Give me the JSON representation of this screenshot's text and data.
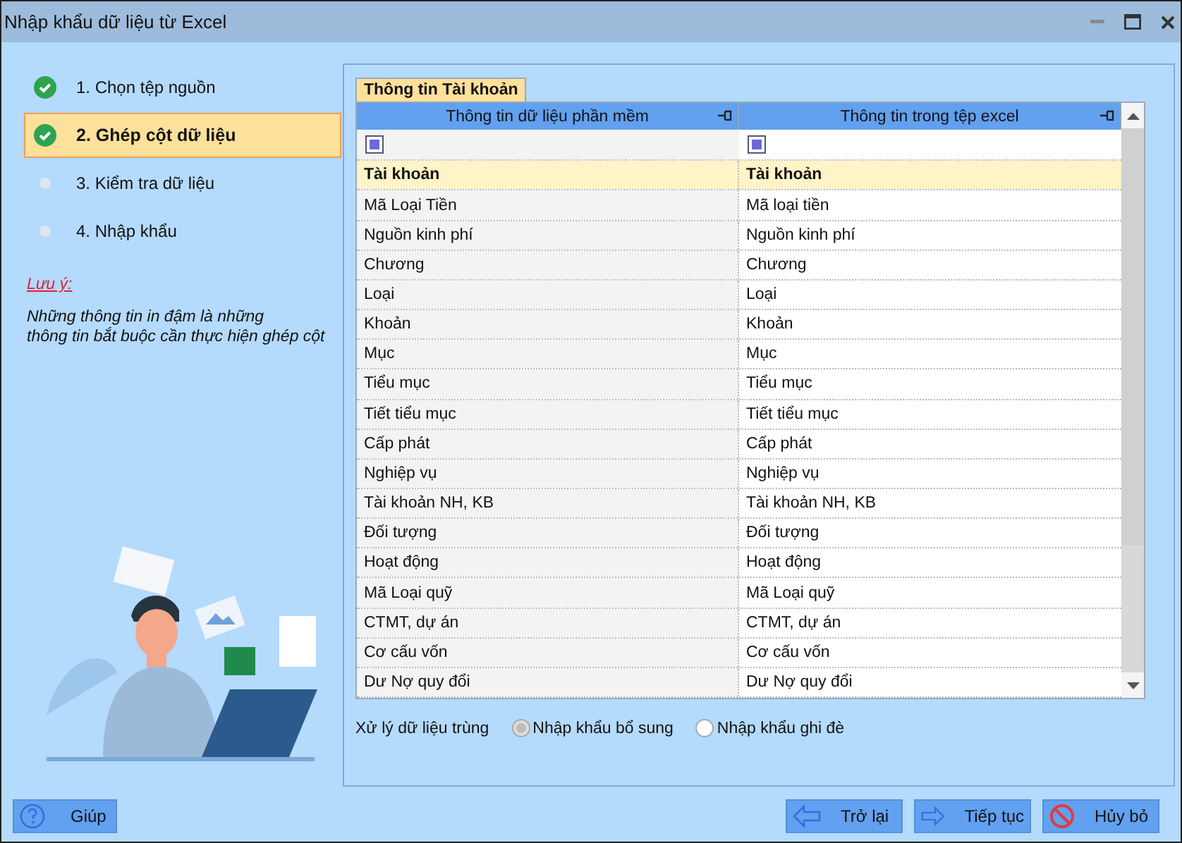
{
  "window": {
    "title": "Nhập khẩu dữ liệu từ Excel"
  },
  "steps": [
    {
      "label": "1. Chọn tệp nguồn",
      "done": true,
      "selected": false
    },
    {
      "label": "2. Ghép cột dữ liệu",
      "done": true,
      "selected": true
    },
    {
      "label": "3. Kiểm tra dữ liệu",
      "done": false,
      "selected": false
    },
    {
      "label": "4. Nhập khẩu",
      "done": false,
      "selected": false
    }
  ],
  "note": {
    "title": "Lưu ý:",
    "text": "Những thông tin in đậm là những\nthông tin bắt buộc cần thực hiện ghép cột"
  },
  "tab": {
    "label": "Thông tin Tài khoản"
  },
  "table": {
    "columns": [
      "Thông tin dữ liệu phần mềm",
      "Thông tin trong tệp excel"
    ],
    "filter_checks": [
      {
        "indeterminate": true
      },
      {
        "indeterminate": true
      }
    ],
    "rows": [
      {
        "cells": [
          "Tài khoản",
          "Tài khoản"
        ],
        "required": true,
        "selected": true
      },
      {
        "cells": [
          "Mã Loại Tiền",
          "Mã loại tiền"
        ],
        "required": false,
        "selected": false
      },
      {
        "cells": [
          "Nguồn kinh phí",
          "Nguồn kinh phí"
        ],
        "required": false,
        "selected": false
      },
      {
        "cells": [
          "Chương",
          "Chương"
        ],
        "required": false,
        "selected": false
      },
      {
        "cells": [
          "Loại",
          "Loại"
        ],
        "required": false,
        "selected": false
      },
      {
        "cells": [
          "Khoản",
          "Khoản"
        ],
        "required": false,
        "selected": false
      },
      {
        "cells": [
          "Mục",
          "Mục"
        ],
        "required": false,
        "selected": false
      },
      {
        "cells": [
          "Tiểu mục",
          "Tiểu mục"
        ],
        "required": false,
        "selected": false
      },
      {
        "cells": [
          "Tiết tiểu mục",
          "Tiết tiểu mục"
        ],
        "required": false,
        "selected": false
      },
      {
        "cells": [
          "Cấp phát",
          "Cấp phát"
        ],
        "required": false,
        "selected": false
      },
      {
        "cells": [
          "Nghiệp vụ",
          "Nghiệp vụ"
        ],
        "required": false,
        "selected": false
      },
      {
        "cells": [
          "Tài khoản NH, KB",
          "Tài khoản NH, KB"
        ],
        "required": false,
        "selected": false
      },
      {
        "cells": [
          "Đối tượng",
          "Đối tượng"
        ],
        "required": false,
        "selected": false
      },
      {
        "cells": [
          "Hoạt động",
          "Hoạt động"
        ],
        "required": false,
        "selected": false
      },
      {
        "cells": [
          "Mã Loại quỹ",
          "Mã Loại quỹ"
        ],
        "required": false,
        "selected": false
      },
      {
        "cells": [
          "CTMT, dự án",
          "CTMT, dự án"
        ],
        "required": false,
        "selected": false
      },
      {
        "cells": [
          "Cơ cấu vốn",
          "Cơ cấu vốn"
        ],
        "required": false,
        "selected": false
      },
      {
        "cells": [
          "Dư Nợ quy đổi",
          "Dư Nợ quy đổi"
        ],
        "required": false,
        "selected": false
      }
    ]
  },
  "duplicates": {
    "label": "Xử lý dữ liệu trùng",
    "options": [
      {
        "label": "Nhập khẩu bổ sung",
        "selected": true
      },
      {
        "label": "Nhập khẩu ghi đè",
        "selected": false
      }
    ]
  },
  "buttons": [
    {
      "label": "Giúp",
      "kind": "help"
    },
    {
      "label": "Trở lại",
      "kind": "back"
    },
    {
      "label": "Tiếp tục",
      "kind": "next"
    },
    {
      "label": "Hủy bỏ",
      "kind": "cancel"
    }
  ]
}
